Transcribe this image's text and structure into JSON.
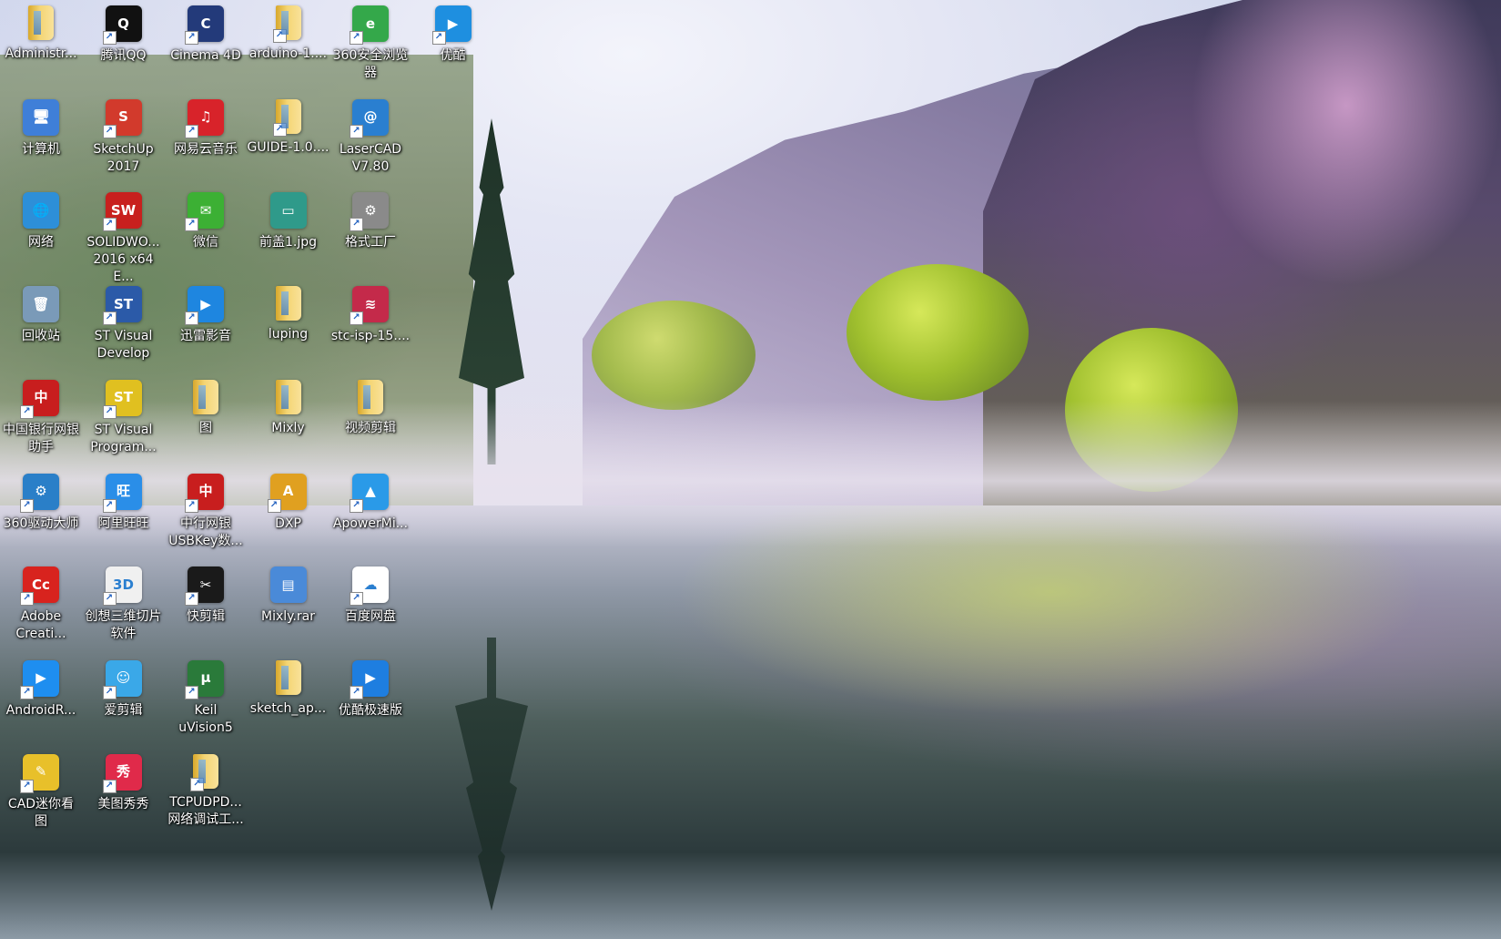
{
  "desktop": {
    "icons": [
      {
        "label": "Administr...",
        "icon": "user-folder-icon",
        "color": "#d8a82c",
        "glyph": "👤",
        "shortcut": false
      },
      {
        "label": "腾讯QQ",
        "icon": "qq-penguin-icon",
        "color": "#111111",
        "glyph": "Q",
        "shortcut": true
      },
      {
        "label": "Cinema 4D",
        "icon": "cinema4d-icon",
        "color": "#233a7a",
        "glyph": "C",
        "shortcut": true
      },
      {
        "label": "arduino-1....",
        "icon": "folder-icon",
        "color": "#d8a82c",
        "glyph": "",
        "shortcut": true
      },
      {
        "label": "360安全浏览\n器",
        "icon": "360-browser-icon",
        "color": "#34a84a",
        "glyph": "e",
        "shortcut": true
      },
      {
        "label": "优酷",
        "icon": "youku-icon",
        "color": "#1e8fe0",
        "glyph": "▶",
        "shortcut": true
      },
      {
        "label": "计算机",
        "icon": "computer-icon",
        "color": "#3f7fd8",
        "glyph": "🖥",
        "shortcut": false
      },
      {
        "label": "SketchUp\n2017",
        "icon": "sketchup-icon",
        "color": "#d23a2c",
        "glyph": "S",
        "shortcut": true
      },
      {
        "label": "网易云音乐",
        "icon": "netease-music-icon",
        "color": "#d8232a",
        "glyph": "♫",
        "shortcut": true
      },
      {
        "label": "GUIDE-1.0....",
        "icon": "folder-icon",
        "color": "#d8a82c",
        "glyph": "",
        "shortcut": true
      },
      {
        "label": "LaserCAD\nV7.80",
        "icon": "lasercad-icon",
        "color": "#2a7fd0",
        "glyph": "@",
        "shortcut": true
      },
      {
        "label": "网络",
        "icon": "network-icon",
        "color": "#2d8fd8",
        "glyph": "🌐",
        "shortcut": false
      },
      {
        "label": "SOLIDWO...\n2016 x64 E...",
        "icon": "solidworks-icon",
        "color": "#c8201e",
        "glyph": "SW",
        "shortcut": true
      },
      {
        "label": "微信",
        "icon": "wechat-icon",
        "color": "#3cb034",
        "glyph": "✉",
        "shortcut": true
      },
      {
        "label": "前盖1.jpg",
        "icon": "image-file-icon",
        "color": "#2f9a8a",
        "glyph": "▭",
        "shortcut": false
      },
      {
        "label": "格式工厂",
        "icon": "format-factory-icon",
        "color": "#8a8a8a",
        "glyph": "⚙",
        "shortcut": true
      },
      {
        "label": "回收站",
        "icon": "recycle-bin-icon",
        "color": "#7a9ab8",
        "glyph": "🗑",
        "shortcut": false
      },
      {
        "label": "ST Visual\nDevelop",
        "icon": "st-visual-develop-icon",
        "color": "#2b5aa8",
        "glyph": "ST",
        "shortcut": true
      },
      {
        "label": "迅雷影音",
        "icon": "xunlei-player-icon",
        "color": "#1e86e0",
        "glyph": "▶",
        "shortcut": true
      },
      {
        "label": "luping",
        "icon": "folder-icon",
        "color": "#d8a82c",
        "glyph": "",
        "shortcut": false
      },
      {
        "label": "stc-isp-15....",
        "icon": "stc-isp-icon",
        "color": "#c42a4a",
        "glyph": "≋",
        "shortcut": true
      },
      {
        "label": "中国银行网银\n助手",
        "icon": "boc-bank-icon",
        "color": "#c81e1e",
        "glyph": "中",
        "shortcut": true
      },
      {
        "label": "ST Visual\nProgram...",
        "icon": "st-visual-program-icon",
        "color": "#e0c020",
        "glyph": "ST",
        "shortcut": true
      },
      {
        "label": "图",
        "icon": "folder-icon",
        "color": "#d8a82c",
        "glyph": "",
        "shortcut": false
      },
      {
        "label": "Mixly",
        "icon": "folder-icon",
        "color": "#d8a82c",
        "glyph": "",
        "shortcut": false
      },
      {
        "label": "视频剪辑",
        "icon": "folder-icon",
        "color": "#d8a82c",
        "glyph": "",
        "shortcut": false
      },
      {
        "label": "360驱动大师",
        "icon": "360-driver-icon",
        "color": "#2a7fc8",
        "glyph": "⚙",
        "shortcut": true
      },
      {
        "label": "阿里旺旺",
        "icon": "aliwangwang-icon",
        "color": "#2a8ee8",
        "glyph": "旺",
        "shortcut": true
      },
      {
        "label": "中行网银\nUSBKey数...",
        "icon": "boc-usbkey-icon",
        "color": "#c81e1e",
        "glyph": "中",
        "shortcut": true
      },
      {
        "label": "DXP",
        "icon": "dxp-icon",
        "color": "#e0a020",
        "glyph": "A",
        "shortcut": true
      },
      {
        "label": "ApowerMi...",
        "icon": "apowermirror-icon",
        "color": "#2a9ae8",
        "glyph": "▲",
        "shortcut": true
      },
      {
        "label": "Adobe\nCreati...",
        "icon": "adobe-creative-cloud-icon",
        "color": "#d8231e",
        "glyph": "Cc",
        "shortcut": true
      },
      {
        "label": "创想三维切片\n软件",
        "icon": "creality-slicer-icon",
        "color": "#f0f0f0",
        "glyph": "3D",
        "shortcut": true
      },
      {
        "label": "快剪辑",
        "icon": "kuaijianji-icon",
        "color": "#1a1a1a",
        "glyph": "✂",
        "shortcut": true
      },
      {
        "label": "Mixly.rar",
        "icon": "rar-archive-icon",
        "color": "#4a8ad8",
        "glyph": "▤",
        "shortcut": false
      },
      {
        "label": "百度网盘",
        "icon": "baidu-netdisk-icon",
        "color": "#ffffff",
        "glyph": "☁",
        "shortcut": true
      },
      {
        "label": "AndroidR...",
        "icon": "android-recorder-icon",
        "color": "#1e8ef0",
        "glyph": "▶",
        "shortcut": true
      },
      {
        "label": "爱剪辑",
        "icon": "aijianji-icon",
        "color": "#3aa8e8",
        "glyph": "☺",
        "shortcut": true
      },
      {
        "label": "Keil\nuVision5",
        "icon": "keil-uvision-icon",
        "color": "#2a7a3a",
        "glyph": "μ",
        "shortcut": true
      },
      {
        "label": "sketch_ap...",
        "icon": "folder-icon",
        "color": "#d8a82c",
        "glyph": "",
        "shortcut": false
      },
      {
        "label": "优酷极速版",
        "icon": "youku-express-icon",
        "color": "#1e7ee0",
        "glyph": "▶",
        "shortcut": true
      },
      {
        "label": "CAD迷你看\n图",
        "icon": "cad-viewer-icon",
        "color": "#e8c02a",
        "glyph": "✎",
        "shortcut": true
      },
      {
        "label": "美图秀秀",
        "icon": "meitu-icon",
        "color": "#e02a4a",
        "glyph": "秀",
        "shortcut": true
      },
      {
        "label": "TCPUDPD...\n网络调试工...",
        "icon": "folder-icon",
        "color": "#d8a82c",
        "glyph": "",
        "shortcut": true
      }
    ]
  }
}
